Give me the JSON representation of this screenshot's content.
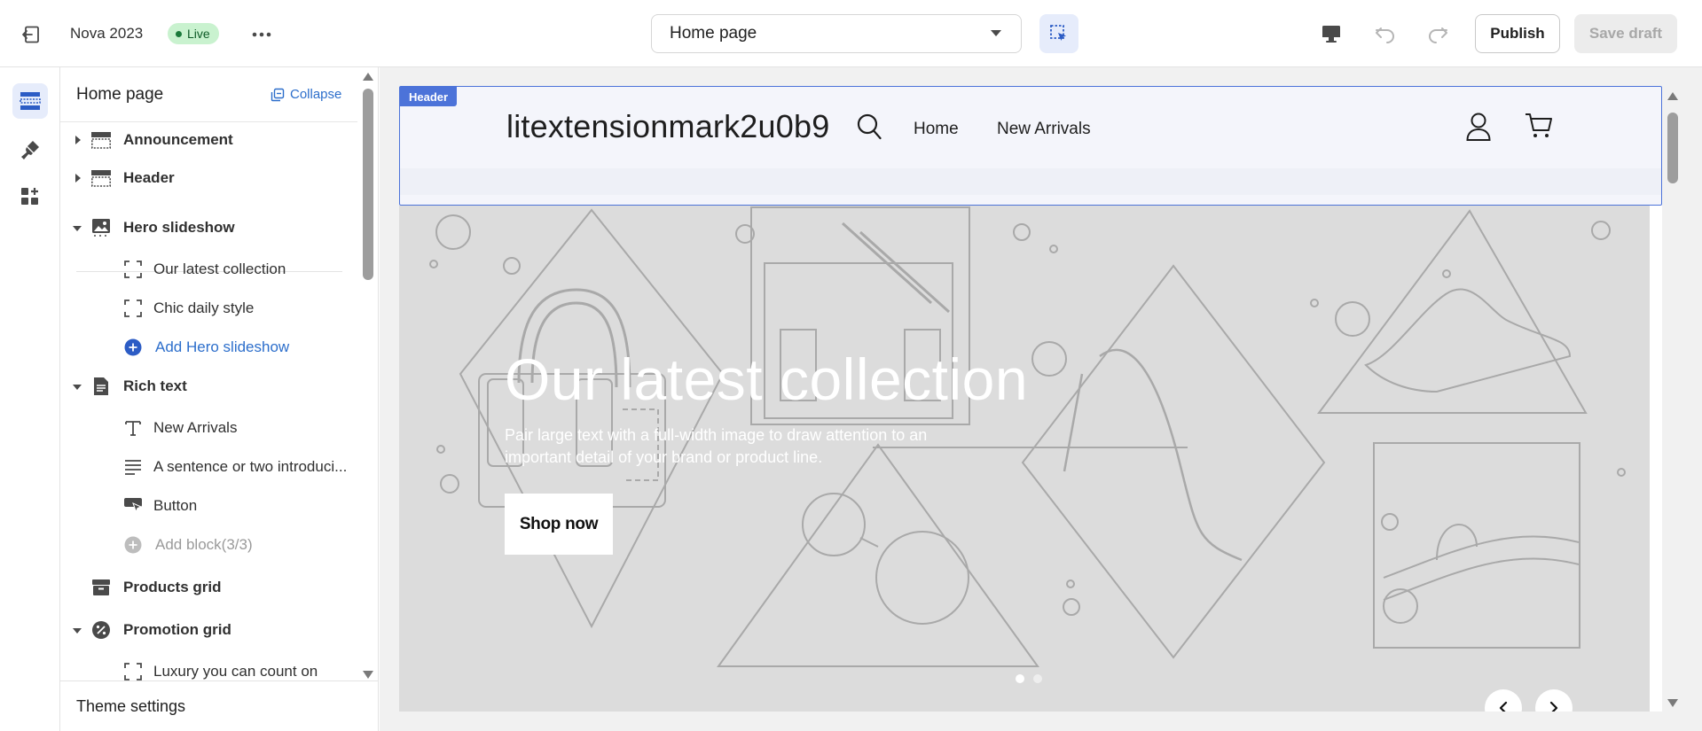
{
  "topbar": {
    "theme_name": "Nova 2023",
    "status_badge": "Live",
    "page_selector": "Home page",
    "publish_label": "Publish",
    "save_draft_label": "Save draft",
    "icons": [
      "exit-icon",
      "more-icon",
      "inspect-icon",
      "desktop-icon",
      "undo-icon",
      "redo-icon"
    ]
  },
  "sidebar": {
    "title": "Home page",
    "collapse_label": "Collapse",
    "items": [
      {
        "label": "Announcement",
        "type": "section",
        "expandable": true,
        "expanded": false
      },
      {
        "label": "Header",
        "type": "section",
        "expandable": true,
        "expanded": false
      },
      {
        "label": "Hero slideshow",
        "type": "section",
        "expandable": true,
        "expanded": true
      },
      {
        "label": "Our latest collection",
        "type": "block"
      },
      {
        "label": "Chic daily style",
        "type": "block"
      },
      {
        "label": "Add Hero slideshow",
        "type": "add"
      },
      {
        "label": "Rich text",
        "type": "section",
        "expandable": true,
        "expanded": true
      },
      {
        "label": "New Arrivals",
        "type": "block"
      },
      {
        "label": "A sentence or two introduci...",
        "type": "block"
      },
      {
        "label": "Button",
        "type": "block"
      },
      {
        "label": "Add block(3/3)",
        "type": "add-disabled"
      },
      {
        "label": "Products grid",
        "type": "section",
        "expandable": false
      },
      {
        "label": "Promotion grid",
        "type": "section",
        "expandable": true,
        "expanded": true
      },
      {
        "label": "Luxury you can count on",
        "type": "block"
      }
    ],
    "footer_label": "Theme settings"
  },
  "preview": {
    "header_tag": "Header",
    "store_name": "litextensionmark2u0b9",
    "nav": [
      "Home",
      "New Arrivals"
    ],
    "hero": {
      "title": "Our latest collection",
      "text": "Pair large text with a full-width image to draw attention to an important detail of your brand or product line.",
      "button_label": "Shop now",
      "slides": 2,
      "active_slide": 1
    }
  },
  "colors": {
    "accent": "#4c73d9",
    "link": "#2c6ecb",
    "live_badge_bg": "#c9f2cf",
    "hero_bg": "#dcdcdc"
  }
}
